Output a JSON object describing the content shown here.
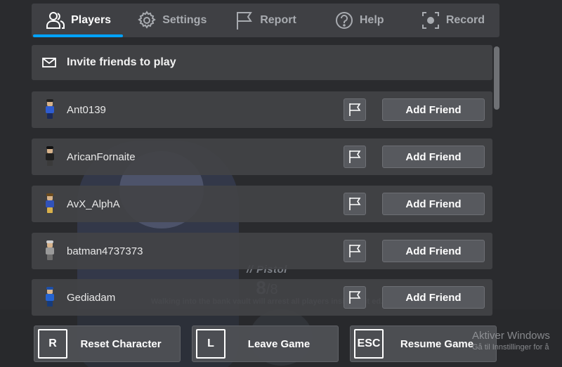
{
  "tabs": [
    {
      "label": "Players",
      "icon": "players-icon",
      "active": true
    },
    {
      "label": "Settings",
      "icon": "gear-icon",
      "active": false
    },
    {
      "label": "Report",
      "icon": "flag-icon",
      "active": false
    },
    {
      "label": "Help",
      "icon": "help-icon",
      "active": false
    },
    {
      "label": "Record",
      "icon": "record-icon",
      "active": false
    }
  ],
  "invite": {
    "label": "Invite friends to play",
    "icon": "mail-icon"
  },
  "players": [
    {
      "name": "Ant0139",
      "button": "Add Friend",
      "colors": {
        "hair": "#222222",
        "torso": "#2f5ccf",
        "legs": "#1b2a5a"
      }
    },
    {
      "name": "AricanFornaite",
      "button": "Add Friend",
      "colors": {
        "hair": "#111111",
        "torso": "#202020",
        "legs": "#3a3a3a"
      }
    },
    {
      "name": "AvX_AlphA",
      "button": "Add Friend",
      "colors": {
        "hair": "#6b4a1c",
        "torso": "#3152b8",
        "legs": "#d8b04a"
      }
    },
    {
      "name": "batman4737373",
      "button": "Add Friend",
      "colors": {
        "hair": "#cfcfcf",
        "torso": "#9a9a9a",
        "legs": "#6d6d6d"
      }
    },
    {
      "name": "Gediadam",
      "button": "Add Friend",
      "colors": {
        "hair": "#1d4fa8",
        "torso": "#2563d0",
        "legs": "#173b7a"
      }
    }
  ],
  "hud": {
    "weapon": "// Pistol",
    "ammo": "8",
    "ammo_sep": "/",
    "ammo_max": "8",
    "message": "Walking into the bank vault will arrest all players inside of it ed."
  },
  "bottom_buttons": [
    {
      "key": "R",
      "label": "Reset Character"
    },
    {
      "key": "L",
      "label": "Leave Game"
    },
    {
      "key": "ESC",
      "label": "Resume Game"
    }
  ],
  "watermark": {
    "line1": "Aktiver Windows",
    "line2": "Gå til Innstillinger for å"
  },
  "colors": {
    "accent": "#00a2ff",
    "panel": "#3f4044",
    "button": "#57595e"
  }
}
